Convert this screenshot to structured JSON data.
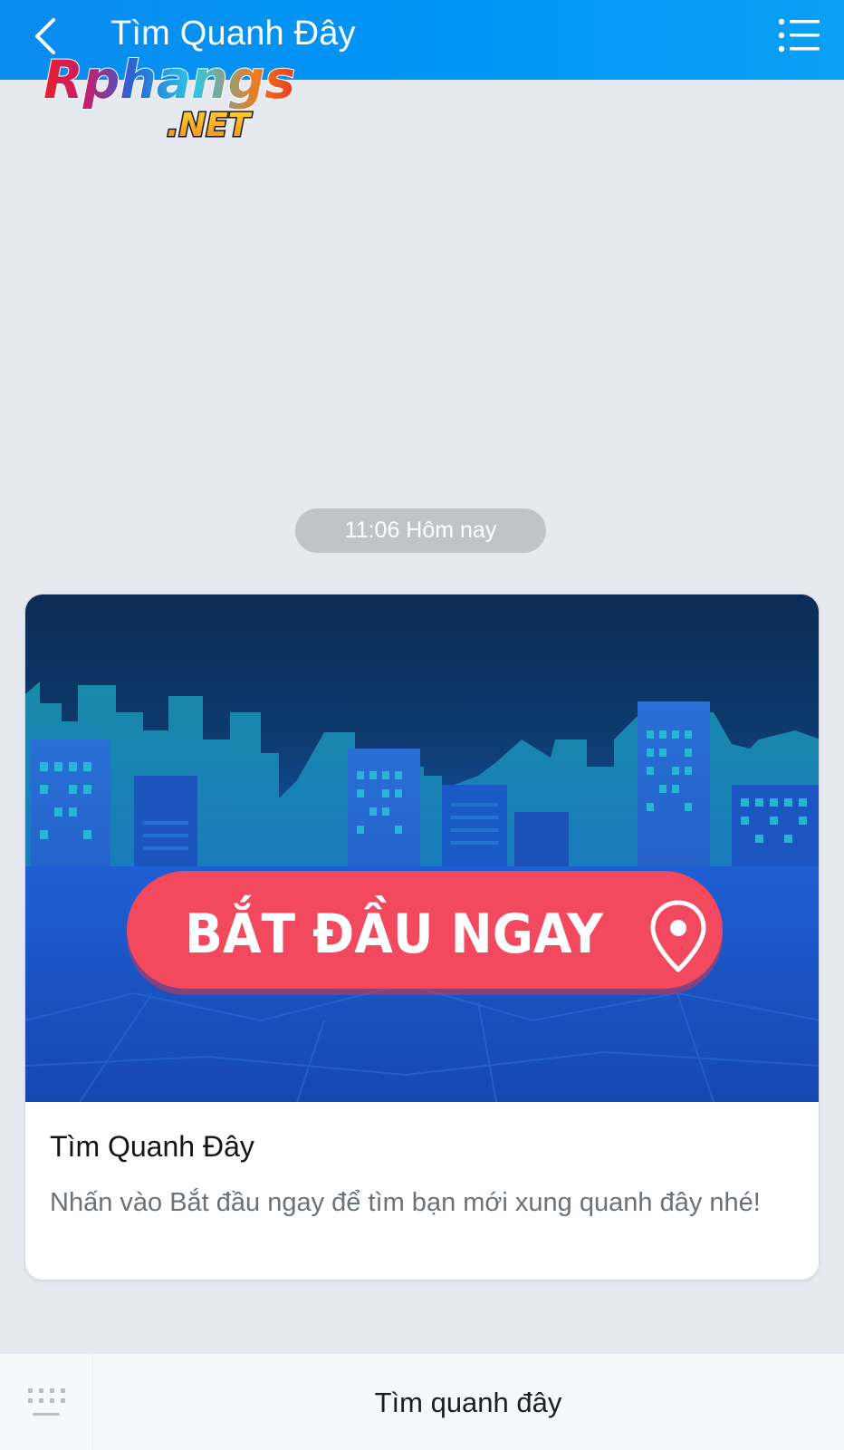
{
  "header": {
    "title": "Tìm Quanh Đây",
    "back_icon": "chevron-left-icon",
    "menu_icon": "list-menu-icon",
    "background": "#0096f5"
  },
  "watermark": {
    "text_main": "Rphangs",
    "text_sub": ".NET"
  },
  "chat": {
    "timestamp": "11:06 Hôm nay"
  },
  "card": {
    "banner": {
      "button_text": "BẮT ĐẦU NGAY",
      "pin_icon": "location-pin-icon",
      "button_color": "#f2495e"
    },
    "title": "Tìm Quanh Đây",
    "description": "Nhấn vào Bắt đầu ngay để tìm bạn mới xung quanh đây nhé!"
  },
  "bottom_bar": {
    "keyboard_icon": "keyboard-toggle-icon",
    "action_label": "Tìm quanh đây"
  }
}
